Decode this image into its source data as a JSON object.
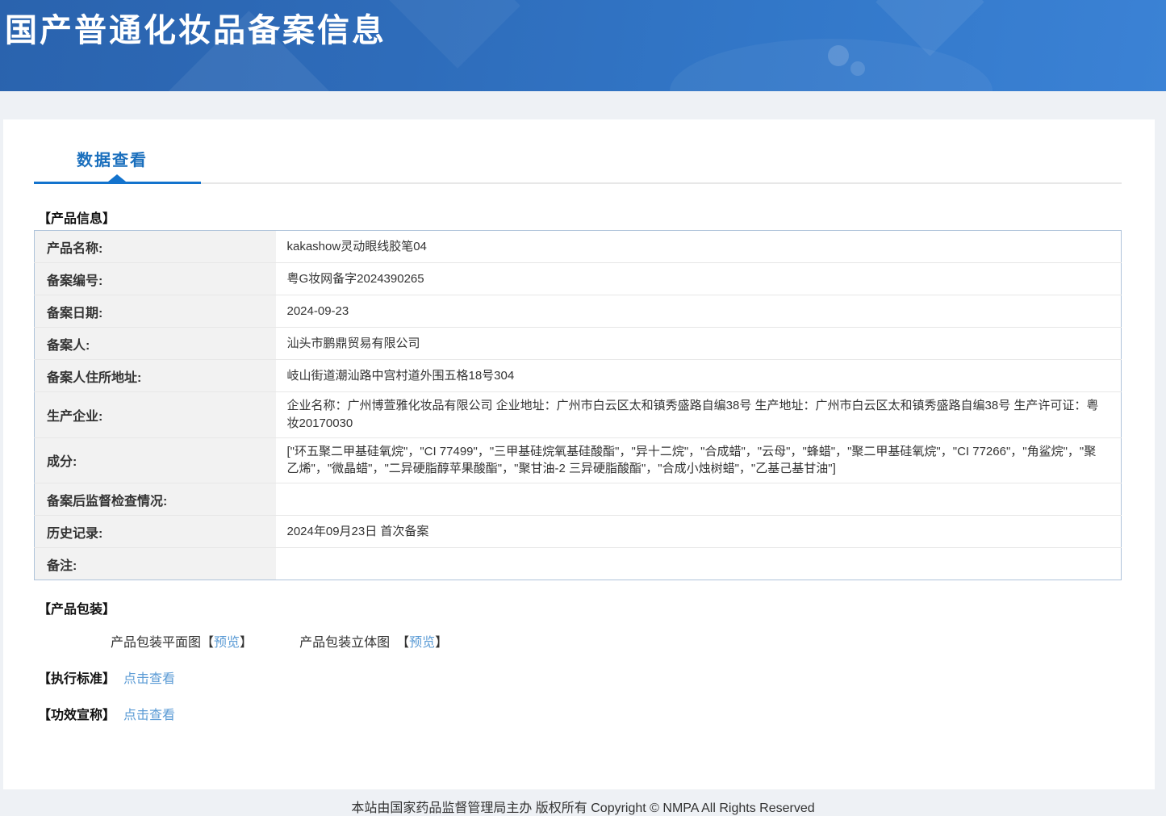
{
  "header": {
    "title": "国产普通化妆品备案信息"
  },
  "tabs": {
    "data_view": "数据查看"
  },
  "sections": {
    "product_info": "【产品信息】",
    "product_packaging": "【产品包装】",
    "execution_standard": "【执行标准】",
    "efficacy_claim": "【功效宣称】"
  },
  "table": {
    "rows": [
      {
        "label": "产品名称:",
        "value": "kakashow灵动眼线胶笔04"
      },
      {
        "label": "备案编号:",
        "value": "粤G妆网备字2024390265"
      },
      {
        "label": "备案日期:",
        "value": "2024-09-23"
      },
      {
        "label": "备案人:",
        "value": "汕头市鹏鼎贸易有限公司"
      },
      {
        "label": "备案人住所地址:",
        "value": "岐山街道潮汕路中宫村道外围五格18号304"
      },
      {
        "label": "生产企业:",
        "value": "企业名称：广州博萱雅化妆品有限公司 企业地址：广州市白云区太和镇秀盛路自编38号 生产地址：广州市白云区太和镇秀盛路自编38号 生产许可证：粤妆20170030"
      },
      {
        "label": "成分:",
        "value": "[\"环五聚二甲基硅氧烷\"，\"CI 77499\"，\"三甲基硅烷氧基硅酸酯\"，\"异十二烷\"，\"合成蜡\"，\"云母\"，\"蜂蜡\"，\"聚二甲基硅氧烷\"，\"CI 77266\"，\"角鲨烷\"，\"聚乙烯\"，\"微晶蜡\"，\"二异硬脂醇苹果酸酯\"，\"聚甘油-2 三异硬脂酸酯\"，\"合成小烛树蜡\"，\"乙基己基甘油\"]"
      },
      {
        "label": "备案后监督检查情况:",
        "value": ""
      },
      {
        "label": "历史记录:",
        "value": "2024年09月23日 首次备案"
      },
      {
        "label": "备注:",
        "value": ""
      }
    ]
  },
  "packaging": {
    "flat_label": "产品包装平面图",
    "stereo_label": "产品包装立体图",
    "bracket_open": "【",
    "bracket_close": "】",
    "preview_link": "预览"
  },
  "links": {
    "click_view": "点击查看"
  },
  "footer": {
    "copyright": "本站由国家药品监督管理局主办 版权所有 Copyright © NMPA All Rights Reserved"
  },
  "colors": {
    "banner_blue": "#2f72c4",
    "tab_blue": "#1a6fbd",
    "underline_blue": "#1373cd",
    "link_blue": "#5b9bd5",
    "label_bg": "#f2f2f2",
    "table_border": "#aec3da"
  }
}
